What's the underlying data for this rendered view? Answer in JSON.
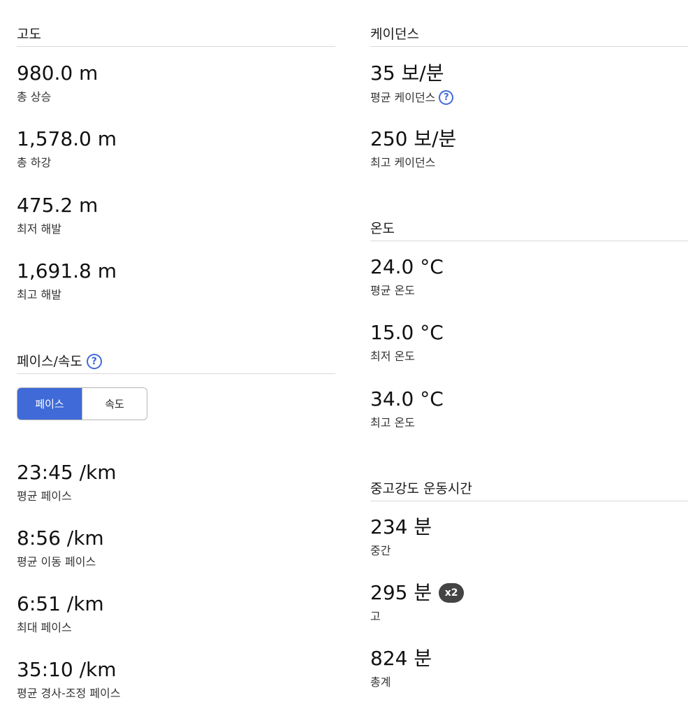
{
  "elevation": {
    "title": "고도",
    "stats": [
      {
        "value": "980.0 m",
        "label": "총 상승"
      },
      {
        "value": "1,578.0 m",
        "label": "총 하강"
      },
      {
        "value": "475.2 m",
        "label": "최저 해발"
      },
      {
        "value": "1,691.8 m",
        "label": "최고 해발"
      }
    ]
  },
  "pace_speed": {
    "title": "페이스/속도",
    "help_icon": "?",
    "toggle": {
      "pace_label": "페이스",
      "speed_label": "속도",
      "selected": "페이스"
    },
    "stats": [
      {
        "value": "23:45 /km",
        "label": "평균 페이스"
      },
      {
        "value": "8:56 /km",
        "label": "평균 이동 페이스"
      },
      {
        "value": "6:51 /km",
        "label": "최대 페이스"
      },
      {
        "value": "35:10 /km",
        "label": "평균 경사-조정 페이스"
      }
    ]
  },
  "cadence": {
    "title": "케이던스",
    "help_icon": "?",
    "stats": [
      {
        "value": "35 보/분",
        "label": "평균 케이던스"
      },
      {
        "value": "250 보/분",
        "label": "최고 케이던스"
      }
    ]
  },
  "temperature": {
    "title": "온도",
    "stats": [
      {
        "value": "24.0 °C",
        "label": "평균 온도"
      },
      {
        "value": "15.0 °C",
        "label": "최저 온도"
      },
      {
        "value": "34.0 °C",
        "label": "최고 온도"
      }
    ]
  },
  "intensity": {
    "title": "중고강도 운동시간",
    "badge": "x2",
    "stats": [
      {
        "value": "234 분",
        "label": "중간"
      },
      {
        "value": "295 분",
        "label": "고"
      },
      {
        "value": "824 분",
        "label": "총계"
      }
    ]
  },
  "colors": {
    "accent": "#3f6ad8",
    "badge_bg": "#444444",
    "divider": "#d9d9d9"
  },
  "icons": {
    "help": "question-circle-icon",
    "multiplier": "x2-badge-icon"
  }
}
